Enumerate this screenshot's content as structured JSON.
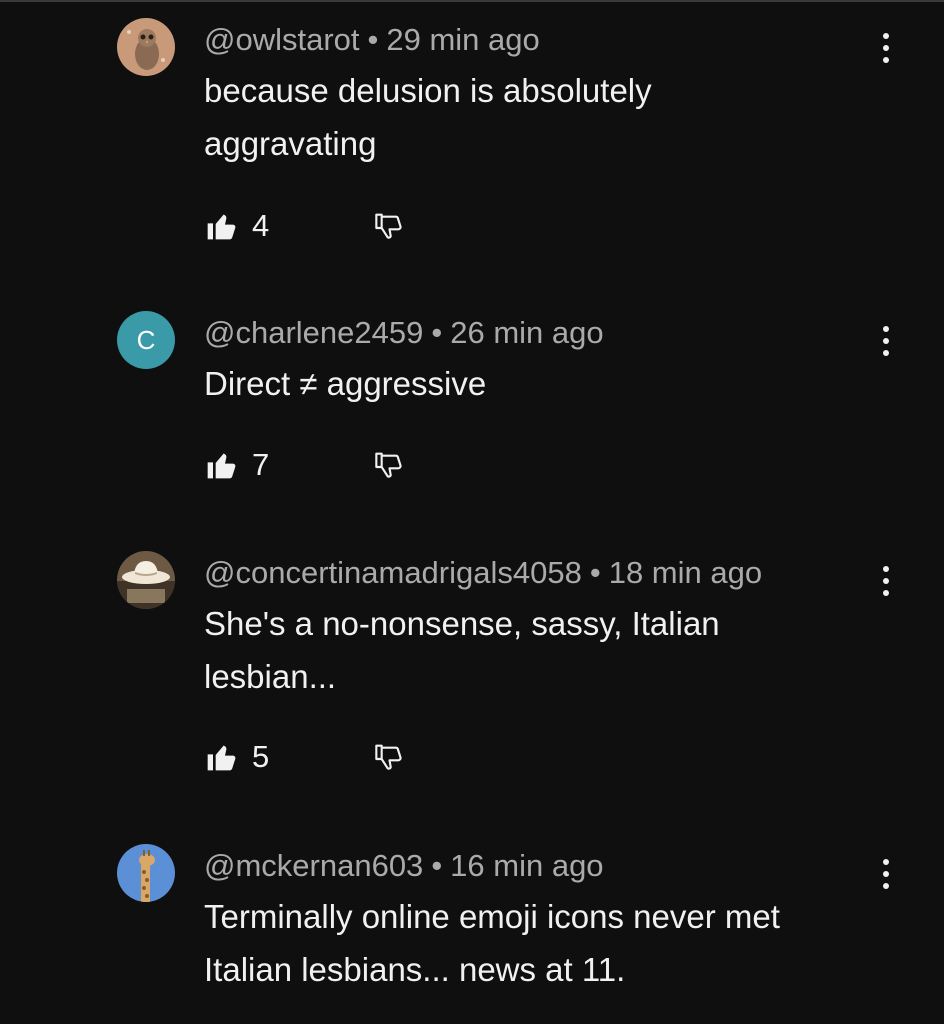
{
  "comments": [
    {
      "username": "@owlstarot",
      "time": "29 min ago",
      "text": "because delusion is absolutely aggravating",
      "likes": "4",
      "avatar": {
        "type": "image",
        "icon": "owl-avatar",
        "bg": "#c89a7a"
      }
    },
    {
      "username": "@charlene2459",
      "time": "26 min ago",
      "text": "Direct ≠ aggressive",
      "likes": "7",
      "avatar": {
        "type": "letter",
        "letter": "C",
        "bg": "#3a9aa8"
      }
    },
    {
      "username": "@concertinamadrigals4058",
      "time": "18 min ago",
      "text": "She's a no-nonsense, sassy, Italian lesbian...",
      "likes": "5",
      "avatar": {
        "type": "image",
        "icon": "cowboy-hat-avatar",
        "bg": "#8a7355"
      }
    },
    {
      "username": "@mckernan603",
      "time": "16 min ago",
      "text": "Terminally online emoji icons never met Italian lesbians... news at 11.",
      "likes": "",
      "avatar": {
        "type": "image",
        "icon": "giraffe-avatar",
        "bg": "#5b8fd6"
      }
    }
  ],
  "separator": "•"
}
